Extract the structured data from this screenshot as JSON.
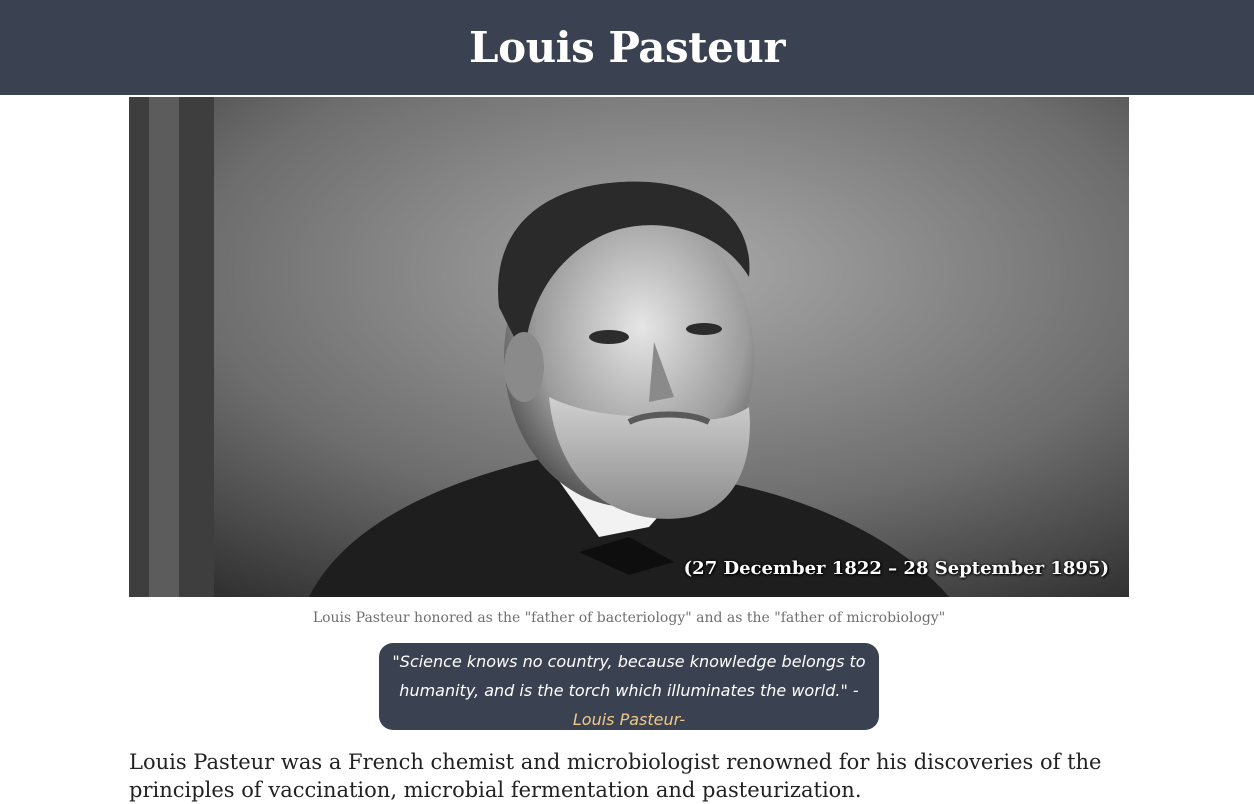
{
  "header": {
    "title": "Louis Pasteur"
  },
  "photo": {
    "alt": "Portrait photograph of Louis Pasteur",
    "dates": "(27 December 1822 – 28 September 1895)"
  },
  "caption": "Louis Pasteur honored as the \"father of bacteriology\" and as the \"father of microbiology\"",
  "quote": {
    "text": "\"Science knows no country, because knowledge belongs to humanity, and is the torch which illuminates the world.\" -",
    "author": "Louis Pasteur-"
  },
  "intro": "Louis Pasteur was a French chemist and microbiologist renowned for his discoveries of the principles of vaccination, microbial fermentation and pasteurization.",
  "colors": {
    "header_bg": "#3a4150",
    "quote_author": "#f0c88a",
    "caption_text": "#6f6f6f"
  }
}
